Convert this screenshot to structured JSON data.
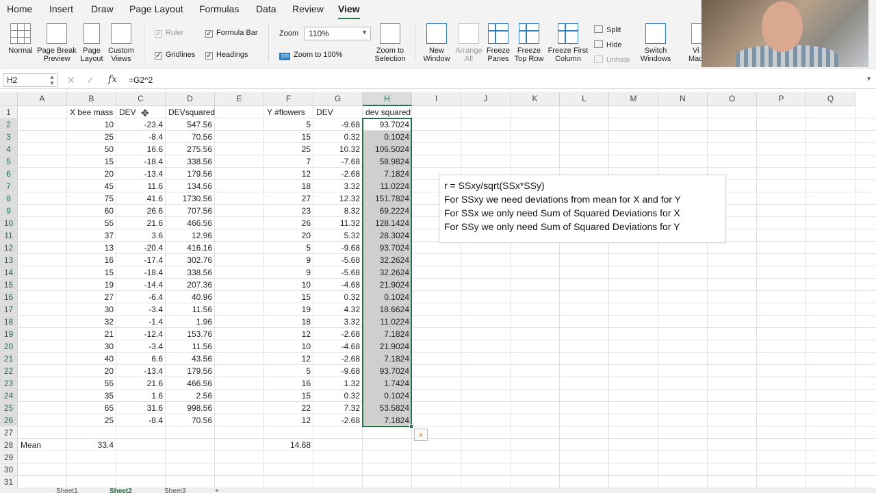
{
  "ribbon": {
    "tabs": [
      "Home",
      "Insert",
      "Draw",
      "Page Layout",
      "Formulas",
      "Data",
      "Review",
      "View"
    ],
    "active_tab": "View",
    "views": {
      "normal": "Normal",
      "page_break_1": "Page Break",
      "page_break_2": "Preview",
      "page_layout_1": "Page",
      "page_layout_2": "Layout",
      "custom_1": "Custom",
      "custom_2": "Views"
    },
    "show": {
      "ruler": "Ruler",
      "formula_bar": "Formula Bar",
      "gridlines": "Gridlines",
      "headings": "Headings"
    },
    "zoom": {
      "label": "Zoom",
      "value": "110%",
      "zoom100": "Zoom to 100%",
      "zoom100_icon": "100",
      "selection_1": "Zoom to",
      "selection_2": "Selection"
    },
    "window": {
      "new_1": "New",
      "new_2": "Window",
      "arrange_1": "Arrange",
      "arrange_2": "All",
      "freeze_panes_1": "Freeze",
      "freeze_panes_2": "Panes",
      "freeze_top_1": "Freeze",
      "freeze_top_2": "Top Row",
      "freeze_first_1": "Freeze First",
      "freeze_first_2": "Column",
      "split": "Split",
      "hide": "Hide",
      "unhide": "Unhide",
      "switch_1": "Switch",
      "switch_2": "Windows",
      "macros_1": "Vi",
      "macros_2": "Mac"
    }
  },
  "formula_bar": {
    "name_box": "H2",
    "cancel_icon": "✕",
    "enter_icon": "✓",
    "fx": "fx",
    "formula": "=G2^2"
  },
  "grid": {
    "columns": [
      "A",
      "B",
      "C",
      "D",
      "E",
      "F",
      "G",
      "H",
      "I",
      "J",
      "K",
      "L",
      "M",
      "N",
      "O",
      "P",
      "Q"
    ],
    "selected_column": "H",
    "rows": [
      "1",
      "2",
      "3",
      "4",
      "5",
      "6",
      "7",
      "8",
      "9",
      "10",
      "11",
      "12",
      "13",
      "14",
      "15",
      "16",
      "17",
      "18",
      "19",
      "20",
      "21",
      "22",
      "23",
      "24",
      "25",
      "26",
      "27",
      "28",
      "29",
      "30",
      "31"
    ],
    "headers": {
      "B": "X bee mass",
      "C": "DEV",
      "D": "DEVsquared",
      "F": "Y #flowers",
      "G": "DEV",
      "H": "dev squared"
    },
    "data": [
      [
        "10",
        "-23.4",
        "547.56",
        "5",
        "-9.68",
        "93.7024"
      ],
      [
        "25",
        "-8.4",
        "70.56",
        "15",
        "0.32",
        "0.1024"
      ],
      [
        "50",
        "16.6",
        "275.56",
        "25",
        "10.32",
        "106.5024"
      ],
      [
        "15",
        "-18.4",
        "338.56",
        "7",
        "-7.68",
        "58.9824"
      ],
      [
        "20",
        "-13.4",
        "179.56",
        "12",
        "-2.68",
        "7.1824"
      ],
      [
        "45",
        "11.6",
        "134.56",
        "18",
        "3.32",
        "11.0224"
      ],
      [
        "75",
        "41.6",
        "1730.56",
        "27",
        "12.32",
        "151.7824"
      ],
      [
        "60",
        "26.6",
        "707.56",
        "23",
        "8.32",
        "69.2224"
      ],
      [
        "55",
        "21.6",
        "466.56",
        "26",
        "11.32",
        "128.1424"
      ],
      [
        "37",
        "3.6",
        "12.96",
        "20",
        "5.32",
        "28.3024"
      ],
      [
        "13",
        "-20.4",
        "416.16",
        "5",
        "-9.68",
        "93.7024"
      ],
      [
        "16",
        "-17.4",
        "302.76",
        "9",
        "-5.68",
        "32.2624"
      ],
      [
        "15",
        "-18.4",
        "338.56",
        "9",
        "-5.68",
        "32.2624"
      ],
      [
        "19",
        "-14.4",
        "207.36",
        "10",
        "-4.68",
        "21.9024"
      ],
      [
        "27",
        "-6.4",
        "40.96",
        "15",
        "0.32",
        "0.1024"
      ],
      [
        "30",
        "-3.4",
        "11.56",
        "19",
        "4.32",
        "18.6624"
      ],
      [
        "32",
        "-1.4",
        "1.96",
        "18",
        "3.32",
        "11.0224"
      ],
      [
        "21",
        "-12.4",
        "153.76",
        "12",
        "-2.68",
        "7.1824"
      ],
      [
        "30",
        "-3.4",
        "11.56",
        "10",
        "-4.68",
        "21.9024"
      ],
      [
        "40",
        "6.6",
        "43.56",
        "12",
        "-2.68",
        "7.1824"
      ],
      [
        "20",
        "-13.4",
        "179.56",
        "5",
        "-9.68",
        "93.7024"
      ],
      [
        "55",
        "21.6",
        "466.56",
        "16",
        "1.32",
        "1.7424"
      ],
      [
        "35",
        "1.6",
        "2.56",
        "15",
        "0.32",
        "0.1024"
      ],
      [
        "65",
        "31.6",
        "998.56",
        "22",
        "7.32",
        "53.5824"
      ],
      [
        "25",
        "-8.4",
        "70.56",
        "12",
        "-2.68",
        "7.1824"
      ]
    ],
    "mean_label": "Mean",
    "mean_x": "33.4",
    "mean_y": "14.68"
  },
  "textbox": {
    "lines": [
      "r = SSxy/sqrt(SSx*SSy)",
      "For SSxy we need deviations from mean for X and for Y",
      "For SSx we only need Sum of Squared Deviations for X",
      "For SSy we only need Sum of Squared Deviations for Y"
    ]
  },
  "sheet_tabs": [
    "Sheet1",
    "Sheet2",
    "Sheet3",
    "+"
  ],
  "active_sheet": "Sheet2",
  "colors": {
    "accent": "#217346",
    "selection_fill": "#cfcfcf",
    "freeze_icon": "#2f7fc1"
  }
}
